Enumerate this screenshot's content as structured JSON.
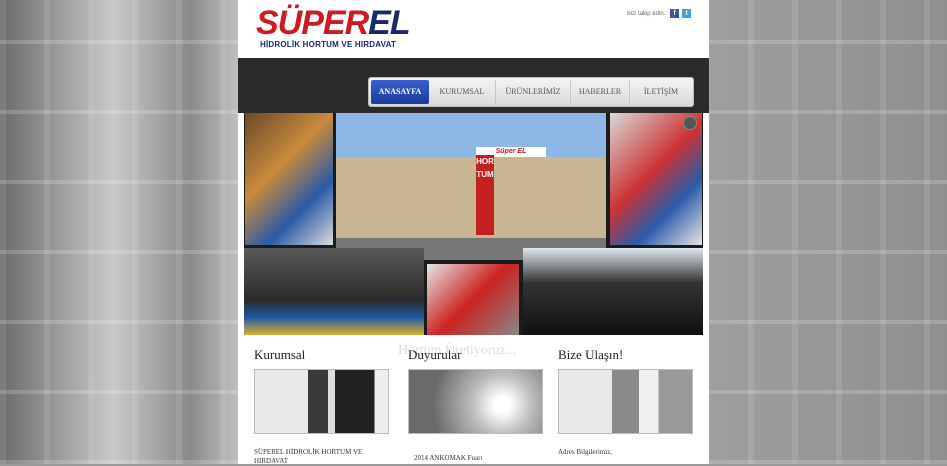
{
  "header": {
    "logo": {
      "text_1": "SÜPER",
      "text_2": "EL",
      "subtitle": "HİDROLİK HORTUM VE HIRDAVAT"
    },
    "follow_text": "bizi takip edin..",
    "social": [
      {
        "icon": "facebook-icon",
        "glyph": "f"
      },
      {
        "icon": "twitter-icon",
        "glyph": "t"
      }
    ]
  },
  "nav": {
    "items": [
      "ANASAYFA",
      "KURUMSAL",
      "ÜRÜNLERİMİZ",
      "HABERLER",
      "İLETİŞİM"
    ],
    "active_index": 0
  },
  "slider": {
    "caption": "Hortum Üretiyoruz...",
    "sign_text": "HORTUM",
    "building_sign": "Süper EL"
  },
  "columns": [
    {
      "title": "Kurumsal",
      "text": "SÜPEREL HİDROLİK HORTUM VE HIRDAVAT"
    },
    {
      "title": "Duyurular",
      "text": "2014 ANKOMAK Fuarı"
    },
    {
      "title": "Bize Ulaşın!",
      "text": "Adres Bilgilerimiz,"
    }
  ],
  "colors": {
    "brand_red": "#d01920",
    "brand_blue": "#1a2a6c",
    "nav_active": "#2a4bb5",
    "nav_band": "#2a2a2a"
  }
}
